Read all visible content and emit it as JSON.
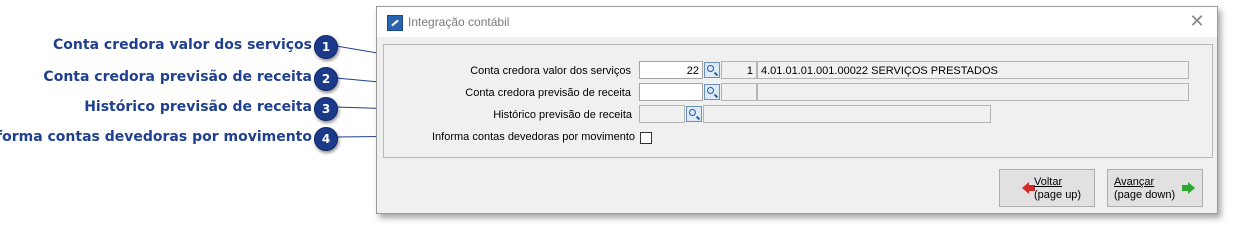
{
  "window": {
    "title": "Integração contábil"
  },
  "callouts": [
    {
      "number": "1",
      "text": "Conta credora valor dos serviços"
    },
    {
      "number": "2",
      "text": "Conta credora previsão de receita"
    },
    {
      "number": "3",
      "text": "Histórico previsão de receita"
    },
    {
      "number": "4",
      "text": "Informa contas devedoras por movimento"
    }
  ],
  "form": {
    "conta_credora_valor": {
      "label": "Conta credora valor dos serviços",
      "value": "22",
      "code": "1",
      "description": "4.01.01.01.001.00022 SERVIÇOS PRESTADOS"
    },
    "conta_credora_previsao": {
      "label": "Conta credora previsão de receita",
      "value": "",
      "code": "",
      "description": ""
    },
    "historico_previsao": {
      "label": "Histórico previsão de receita",
      "value": "",
      "description": ""
    },
    "informa_contas_devedoras": {
      "label": "Informa contas devedoras por movimento",
      "checked": false
    }
  },
  "buttons": {
    "voltar": {
      "line1": "Voltar",
      "line2": "(page up)"
    },
    "avancar": {
      "line1": "Avançar",
      "line2": "(page down)"
    }
  }
}
